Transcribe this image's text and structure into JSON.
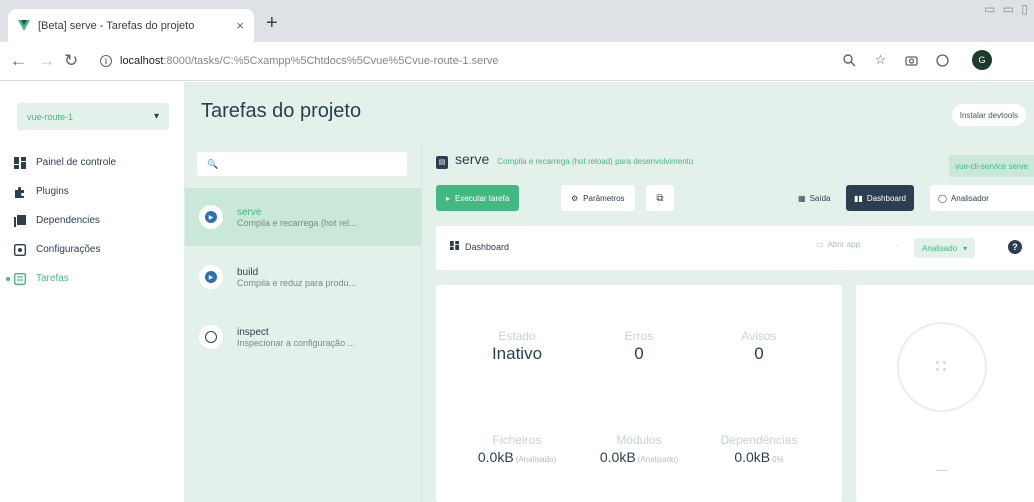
{
  "browser": {
    "tab_title": "[Beta] serve - Tarefas do projeto",
    "tab_close": "×",
    "new_tab": "+",
    "url_host": "localhost",
    "url_path": ":8000/tasks/C:%5Cxampp%5Chtdocs%5Cvue%5Cvue-route-1.serve",
    "profile_initial": "G",
    "window_controls": "▭ ▭ ▯"
  },
  "sidebar": {
    "project_name": "vue-route-1",
    "items": [
      {
        "label": "Painel de controle",
        "icon": "dashboard-icon"
      },
      {
        "label": "Plugins",
        "icon": "puzzle-icon"
      },
      {
        "label": "Dependencies",
        "icon": "library-icon"
      },
      {
        "label": "Configurações",
        "icon": "settings-box-icon"
      },
      {
        "label": "Tarefas",
        "icon": "assignment-icon",
        "active": true
      }
    ]
  },
  "header": {
    "title": "Tarefas do projeto",
    "devtools_label": "Instalar devtools"
  },
  "tasklist": {
    "search_placeholder": "🔍",
    "tasks": [
      {
        "name": "serve",
        "description": "Compila e recarrega (hot rel...",
        "selected": true
      },
      {
        "name": "build",
        "description": "Compila e reduz para produ..."
      },
      {
        "name": "inspect",
        "description": "Inspecionar a configuração ..."
      }
    ]
  },
  "task": {
    "name": "serve",
    "description": "Compila e recarrega (hot reload) para desenvolvimento",
    "command": "vue-cli-service serve",
    "run_label": "Executar tarefa",
    "params_label": "Parâmetros",
    "output_label": "Saída",
    "dashboard_label": "Dashboard",
    "analyzer_label": "Analisador"
  },
  "dashboard": {
    "title": "Dashboard",
    "open_app_label": "Abrir app",
    "separator": "·",
    "analyzer_select": "Analisado",
    "help": "?",
    "stats": {
      "status_label": "Estado",
      "status_value": "Inativo",
      "errors_label": "Erros",
      "errors_value": "0",
      "warnings_label": "Avisos",
      "warnings_value": "0",
      "files_label": "Ficheiros",
      "files_value": "0.0kB",
      "files_suffix": "(Analisado)",
      "modules_label": "Módulos",
      "modules_value": "0.0kB",
      "modules_suffix": "(Analisado)",
      "deps_label": "Dependências",
      "deps_value": "0.0kB",
      "deps_suffix": "0%"
    }
  },
  "colors": {
    "accent": "#42b983",
    "panel_bg": "#e3f1ea",
    "dark": "#2c3e50"
  }
}
